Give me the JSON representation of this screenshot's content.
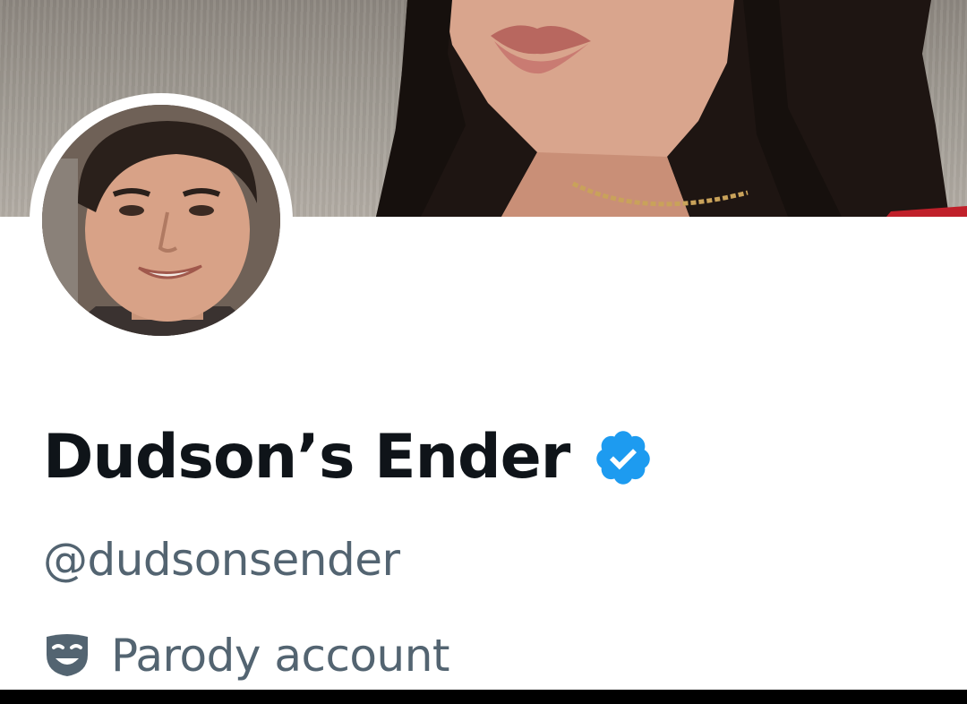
{
  "profile": {
    "display_name": "Dudson’s Ender",
    "handle": "@dudsonsender",
    "label": "Parody account",
    "verified": true
  },
  "icons": {
    "verified": "verified-badge-icon",
    "parody": "theater-mask-icon"
  },
  "colors": {
    "name": "#0f1419",
    "secondary_text": "#536471",
    "verified_badge": "#1d9bf0"
  }
}
